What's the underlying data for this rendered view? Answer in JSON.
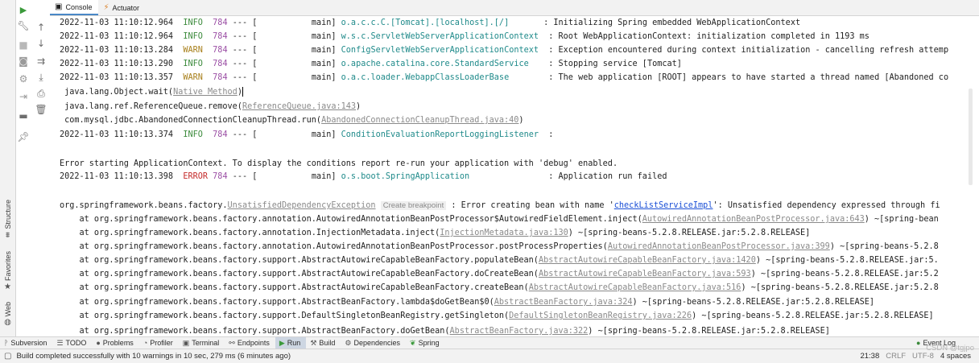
{
  "side_panel": {
    "structure_label": "Structure",
    "favorites_label": "Favorites",
    "web_label": "Web"
  },
  "toolbar_left": {
    "icons": [
      "run-icon",
      "wrench-icon",
      "stop-icon",
      "camera-icon",
      "settings-gear-icon",
      "exit-icon",
      "layout-icon",
      "pin-icon"
    ],
    "icons2": [
      "up-arrow-icon",
      "down-arrow-icon",
      "soft-wrap-icon",
      "scroll-to-end-icon",
      "print-icon",
      "trash-icon"
    ]
  },
  "tabs": [
    {
      "label": "Console",
      "active": true
    },
    {
      "label": "Actuator",
      "active": false
    }
  ],
  "console": {
    "lines": [
      {
        "ts": "2022-11-03 11:10:12.964",
        "level": "INFO ",
        "pid": "784",
        "sep": " --- [",
        "thread": "           main]",
        "logger": " o.a.c.c.C.[Tomcat].[localhost].[/]      ",
        "msg": " : Initializing Spring embedded WebApplicationContext"
      },
      {
        "ts": "2022-11-03 11:10:12.964",
        "level": "INFO ",
        "pid": "784",
        "sep": " --- [",
        "thread": "           main]",
        "logger": " w.s.c.ServletWebServerApplicationContext ",
        "msg": " : Root WebApplicationContext: initialization completed in 1193 ms"
      },
      {
        "ts": "2022-11-03 11:10:13.284",
        "level": "WARN ",
        "pid": "784",
        "sep": " --- [",
        "thread": "           main]",
        "logger": " ConfigServletWebServerApplicationContext ",
        "msg": " : Exception encountered during context initialization - cancelling refresh attemp"
      },
      {
        "ts": "2022-11-03 11:10:13.290",
        "level": "INFO ",
        "pid": "784",
        "sep": " --- [",
        "thread": "           main]",
        "logger": " o.apache.catalina.core.StandardService   ",
        "msg": " : Stopping service [Tomcat]"
      },
      {
        "ts": "2022-11-03 11:10:13.357",
        "level": "WARN ",
        "pid": "784",
        "sep": " --- [",
        "thread": "           main]",
        "logger": " o.a.c.loader.WebappClassLoaderBase       ",
        "msg": " : The web application [ROOT] appears to have started a thread named [Abandoned co"
      }
    ],
    "trace_a": [
      {
        "pre": " java.lang.Object.wait(",
        "link": "Native Method",
        "post": ")",
        "caret": true
      },
      {
        "pre": " java.lang.ref.ReferenceQueue.remove(",
        "link": "ReferenceQueue.java:143",
        "post": ")",
        "caret": false
      },
      {
        "pre": " com.mysql.jdbc.AbandonedConnectionCleanupThread.run(",
        "link": "AbandonedConnectionCleanupThread.java:40",
        "post": ")",
        "caret": false
      }
    ],
    "line_cond": {
      "ts": "2022-11-03 11:10:13.374",
      "level": "INFO ",
      "pid": "784",
      "sep": " --- [",
      "thread": "           main]",
      "logger": " ConditionEvaluationReportLoggingListener ",
      "msg": " :"
    },
    "error_text": "Error starting ApplicationContext. To display the conditions report re-run your application with 'debug' enabled.",
    "line_error": {
      "ts": "2022-11-03 11:10:13.398",
      "level": "ERROR",
      "pid": "784",
      "sep": " --- [",
      "thread": "           main]",
      "logger": " o.s.boot.SpringApplication               ",
      "msg": " : Application run failed"
    },
    "exception": {
      "pre": "org.springframework.beans.factory.",
      "exc_link": "UnsatisfiedDependencyException",
      "breakpoint": "Create breakpoint",
      "mid": " : Error creating bean with name '",
      "bean_link": "checkListServiceImpl",
      "post": "': Unsatisfied dependency expressed through fi"
    },
    "stack": [
      {
        "pre": "    at org.springframework.beans.factory.annotation.AutowiredAnnotationBeanPostProcessor$AutowiredFieldElement.inject(",
        "link": "AutowiredAnnotationBeanPostProcessor.java:643",
        "post": ") ~[spring-bean"
      },
      {
        "pre": "    at org.springframework.beans.factory.annotation.InjectionMetadata.inject(",
        "link": "InjectionMetadata.java:130",
        "post": ") ~[spring-beans-5.2.8.RELEASE.jar:5.2.8.RELEASE]"
      },
      {
        "pre": "    at org.springframework.beans.factory.annotation.AutowiredAnnotationBeanPostProcessor.postProcessProperties(",
        "link": "AutowiredAnnotationBeanPostProcessor.java:399",
        "post": ") ~[spring-beans-5.2.8"
      },
      {
        "pre": "    at org.springframework.beans.factory.support.AbstractAutowireCapableBeanFactory.populateBean(",
        "link": "AbstractAutowireCapableBeanFactory.java:1420",
        "post": ") ~[spring-beans-5.2.8.RELEASE.jar:5."
      },
      {
        "pre": "    at org.springframework.beans.factory.support.AbstractAutowireCapableBeanFactory.doCreateBean(",
        "link": "AbstractAutowireCapableBeanFactory.java:593",
        "post": ") ~[spring-beans-5.2.8.RELEASE.jar:5.2"
      },
      {
        "pre": "    at org.springframework.beans.factory.support.AbstractAutowireCapableBeanFactory.createBean(",
        "link": "AbstractAutowireCapableBeanFactory.java:516",
        "post": ") ~[spring-beans-5.2.8.RELEASE.jar:5.2.8"
      },
      {
        "pre": "    at org.springframework.beans.factory.support.AbstractBeanFactory.lambda$doGetBean$0(",
        "link": "AbstractBeanFactory.java:324",
        "post": ") ~[spring-beans-5.2.8.RELEASE.jar:5.2.8.RELEASE]"
      },
      {
        "pre": "    at org.springframework.beans.factory.support.DefaultSingletonBeanRegistry.getSingleton(",
        "link": "DefaultSingletonBeanRegistry.java:226",
        "post": ") ~[spring-beans-5.2.8.RELEASE.jar:5.2.8.RELEASE]"
      },
      {
        "pre": "    at org.springframework.beans.factory.support.AbstractBeanFactory.doGetBean(",
        "link": "AbstractBeanFactory.java:322",
        "post": ") ~[spring-beans-5.2.8.RELEASE.jar:5.2.8.RELEASE]"
      }
    ]
  },
  "bottom_tabs": [
    {
      "label": "Subversion",
      "icon": "ᚹ",
      "active": false
    },
    {
      "label": "TODO",
      "icon": "☰",
      "active": false
    },
    {
      "label": "Problems",
      "icon": "●",
      "active": false
    },
    {
      "label": "Profiler",
      "icon": "◔",
      "active": false
    },
    {
      "label": "Terminal",
      "icon": "▣",
      "active": false
    },
    {
      "label": "Endpoints",
      "icon": "⚯",
      "active": false
    },
    {
      "label": "Run",
      "icon": "▶",
      "active": true
    },
    {
      "label": "Build",
      "icon": "⚒",
      "active": false
    },
    {
      "label": "Dependencies",
      "icon": "⚙",
      "active": false
    },
    {
      "label": "Spring",
      "icon": "❦",
      "active": false
    }
  ],
  "event_log": "Event Log",
  "status": {
    "message": "Build completed successfully with 10 warnings in 10 sec, 279 ms (6 minutes ago)",
    "position": "21:38",
    "line_sep": "CRLF",
    "encoding": "UTF-8",
    "indent": "4 spaces",
    "watermark": "CSDN @tgjpo"
  }
}
